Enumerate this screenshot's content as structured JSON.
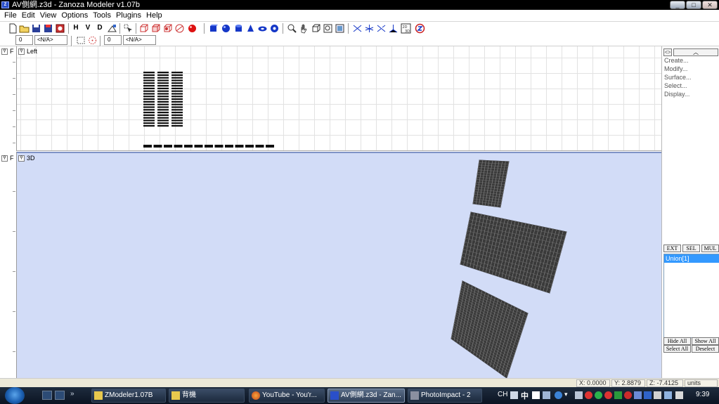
{
  "window": {
    "title": "AV側網.z3d - Zanoza Modeler v1.07b",
    "controls": {
      "minimize": "_",
      "maximize": "□",
      "close": "✕"
    }
  },
  "menu": [
    "File",
    "Edit",
    "View",
    "Options",
    "Tools",
    "Plugins",
    "Help"
  ],
  "toolbar": {
    "letters": [
      "H",
      "V",
      "D"
    ],
    "left_spin_value": "0",
    "left_combo": "<N/A>",
    "right_spin_value": "0",
    "right_combo": "<N/A>"
  },
  "viewports": {
    "top": {
      "mode_button": "F",
      "label": "Left"
    },
    "bottom": {
      "mode_button": "F",
      "label": "3D"
    }
  },
  "right_panel": {
    "header_arrow": "<>",
    "menu_items": [
      "Create...",
      "Modify...",
      "Surface...",
      "Select...",
      "Display..."
    ],
    "mode_buttons": [
      "EXT",
      "SEL",
      "MUL"
    ],
    "object_list": [
      "Union[1]"
    ],
    "action_buttons": [
      "Hide All",
      "Show All",
      "Select All",
      "Deselect"
    ]
  },
  "status": {
    "x": "X: 0.0000",
    "y": "Y: 2.8879",
    "z": "Z: -7.4125",
    "units": "units"
  },
  "taskbar": {
    "tasks": [
      "ZModeler1.07B",
      "背機",
      "YouTube - You'r...",
      "AV側網.z3d - Zan...",
      "PhotoImpact - 2"
    ],
    "active_task_index": 3,
    "language": "CH",
    "ime": "中",
    "time": "9:39"
  },
  "colors": {
    "viewport3d_bg": "#d2dcf7",
    "grid_line": "#e2e2e2",
    "mesh": "#3a3a3a",
    "selection": "#3399ff"
  }
}
